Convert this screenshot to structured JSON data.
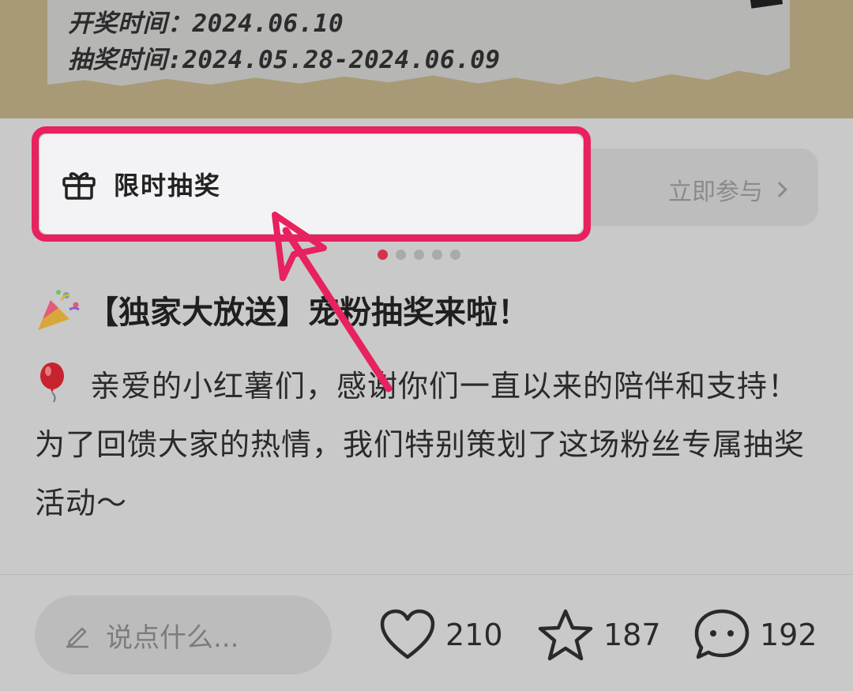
{
  "banner": {
    "draw_date": "开奖时间：2024.06.10",
    "entry_period": "抽奖时间:2024.05.28-2024.06.09"
  },
  "lottery": {
    "title": "限时抽奖",
    "join_label": "立即参与",
    "icon": "gift-icon",
    "highlight_color": "#e8215f"
  },
  "carousel": {
    "total_dots": 5,
    "active_index": 0,
    "active_color": "#d6324d"
  },
  "post": {
    "title": "【独家大放送】宠粉抽奖来啦！",
    "title_icon": "party-popper-icon",
    "body": "亲爱的小红薯们，感谢你们一直以来的陪伴和支持！为了回馈大家的热情，我们特别策划了这场粉丝专属抽奖活动～",
    "body_icon": "balloon-icon"
  },
  "footer": {
    "comment_placeholder": "说点什么...",
    "likes": "210",
    "favorites": "187",
    "comments": "192"
  }
}
